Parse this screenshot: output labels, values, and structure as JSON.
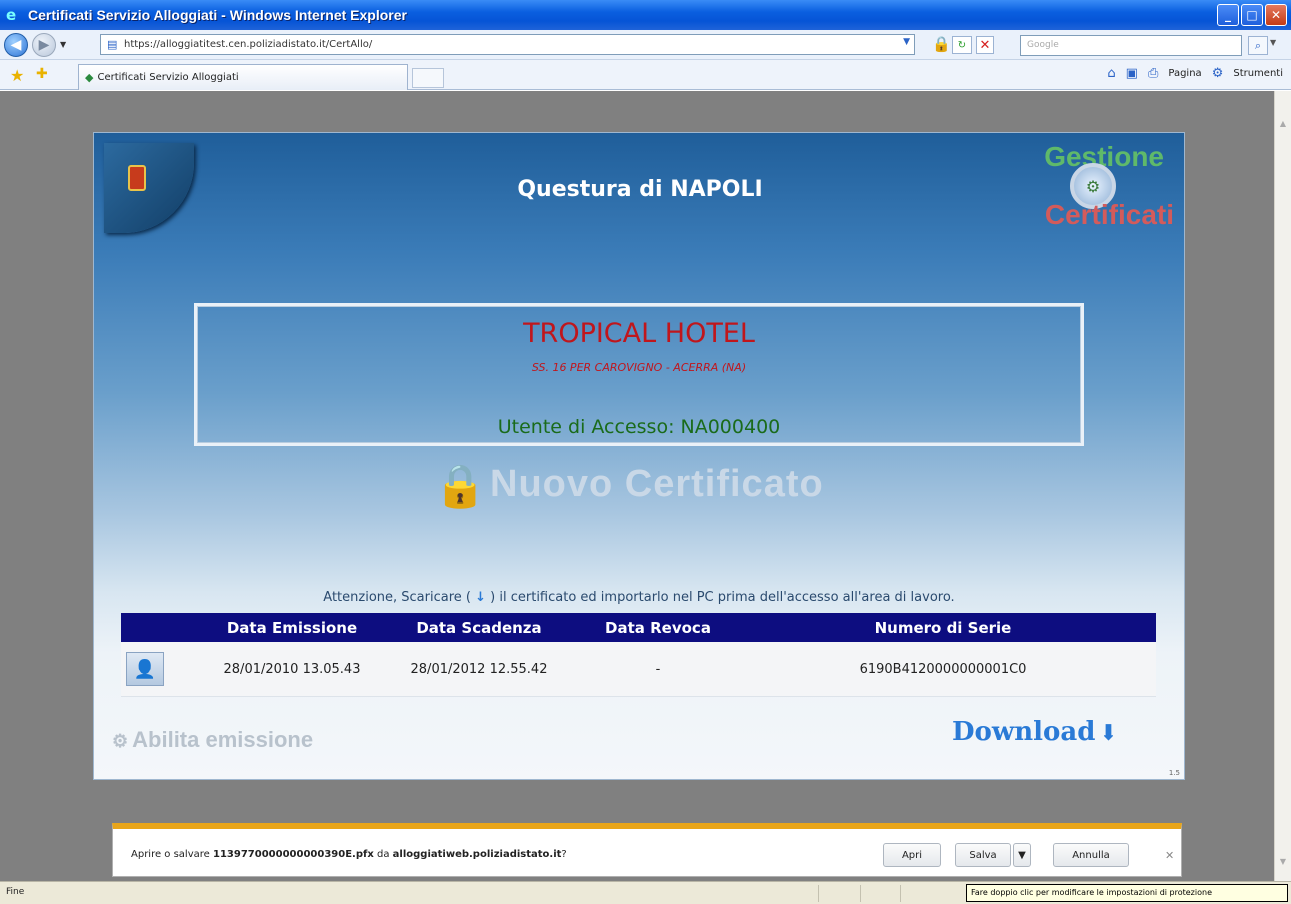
{
  "window": {
    "title": "Certificati Servizio Alloggiati - Windows Internet Explorer",
    "minimize": "_",
    "maximize": "□",
    "close": "✕"
  },
  "address_bar": {
    "url": "https://alloggiatitest.cen.poliziadistato.it/CertAllo/",
    "search_placeholder": "Google"
  },
  "tabs": [
    {
      "label": "Certificati Servizio Alloggiati"
    }
  ],
  "command_bar": {
    "page_menu": "Pagina",
    "tools_menu": "Strumenti"
  },
  "page": {
    "header_title": "Questura di NAPOLI",
    "logo_top": "Gestione",
    "logo_bottom": "Certificati",
    "hotel_name": "TROPICAL HOTEL",
    "hotel_address": "SS. 16 PER CAROVIGNO - ACERRA (NA)",
    "access_user": "Utente di Accesso: NA000400",
    "new_certificate": "Nuovo Certificato",
    "notice_before": "Attenzione, Scaricare (",
    "notice_icon": "↓",
    "notice_after": ") il certificato ed importarlo nel PC prima dell'accesso all'area di lavoro.",
    "table": {
      "headers": [
        "Data Emissione",
        "Data Scadenza",
        "Data Revoca",
        "Numero di Serie"
      ],
      "rows": [
        {
          "emissione": "28/01/2010 13.05.43",
          "scadenza": "28/01/2012 12.55.42",
          "revoca": "-",
          "serie": "6190B4120000000001C0"
        }
      ]
    },
    "enable_issue": "Abilita emissione",
    "download": "Download",
    "version": "1.5"
  },
  "download_bar": {
    "prefix": "Aprire o salvare",
    "filename": "1139770000000000390E.pfx",
    "middle": "da",
    "host": "alloggiatiweb.poliziadistato.it",
    "suffix": "?",
    "open": "Apri",
    "save": "Salva",
    "cancel": "Annulla"
  },
  "status_bar": {
    "status": "Fine",
    "tooltip": "Fare doppio clic per modificare le impostazioni di protezione"
  },
  "colors": {
    "titlebar": "#0654d6",
    "table_header": "#0d0d80",
    "hotel_red": "#c0161c",
    "user_green": "#1a6b1a",
    "download_blue": "#2a7ad6"
  }
}
